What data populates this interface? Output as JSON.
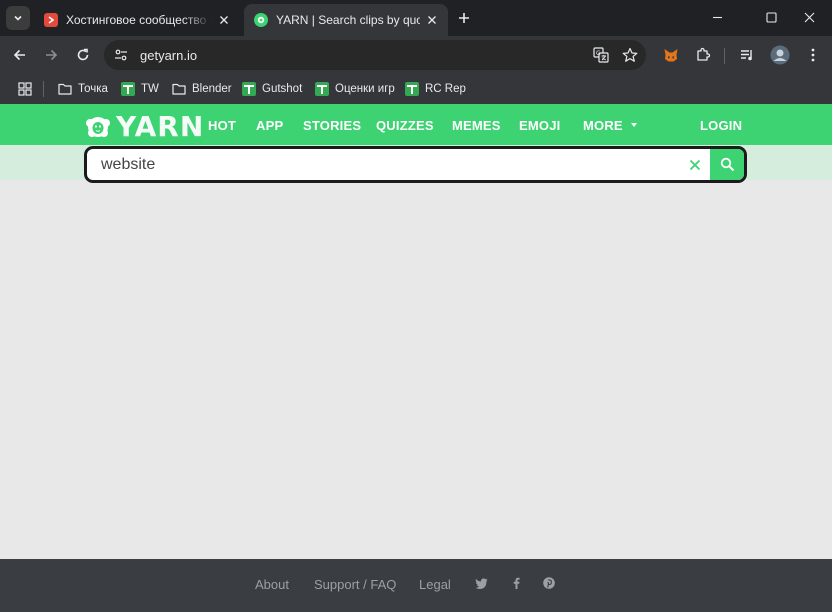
{
  "browser": {
    "tabs": [
      {
        "title": "Хостинговое сообщество «Tim",
        "favicon": "timeweb-favicon",
        "favicon_color": "#e24a3b",
        "active": false
      },
      {
        "title": "YARN | Search clips by quote",
        "favicon": "yarn-favicon",
        "favicon_color": "#3dd372",
        "active": true
      }
    ],
    "address_bar": {
      "url": "getyarn.io"
    },
    "bookmarks": [
      {
        "label": "Точка",
        "icon": "folder-icon"
      },
      {
        "label": "TW",
        "icon": "google-sheets-icon"
      },
      {
        "label": "Blender",
        "icon": "folder-icon"
      },
      {
        "label": "Gutshot",
        "icon": "google-sheets-icon"
      },
      {
        "label": "Оценки игр",
        "icon": "google-sheets-icon"
      },
      {
        "label": "RC Rep",
        "icon": "google-sheets-icon"
      }
    ]
  },
  "site": {
    "logo_text": "YARN",
    "nav": {
      "hot": "HOT",
      "app": "APP",
      "stories": "STORIES",
      "quizzes": "QUIZZES",
      "memes": "MEMES",
      "emoji": "EMOJI",
      "more": "MORE",
      "login": "LOGIN"
    },
    "search": {
      "value": "website"
    },
    "footer": {
      "about": "About",
      "support": "Support / FAQ",
      "legal": "Legal"
    }
  },
  "colors": {
    "brand_green": "#3dd372",
    "search_band": "#d4eddc",
    "page_background": "#e8e8e8",
    "footer_background": "#3a3d42",
    "browser_chrome": "#35363a"
  }
}
